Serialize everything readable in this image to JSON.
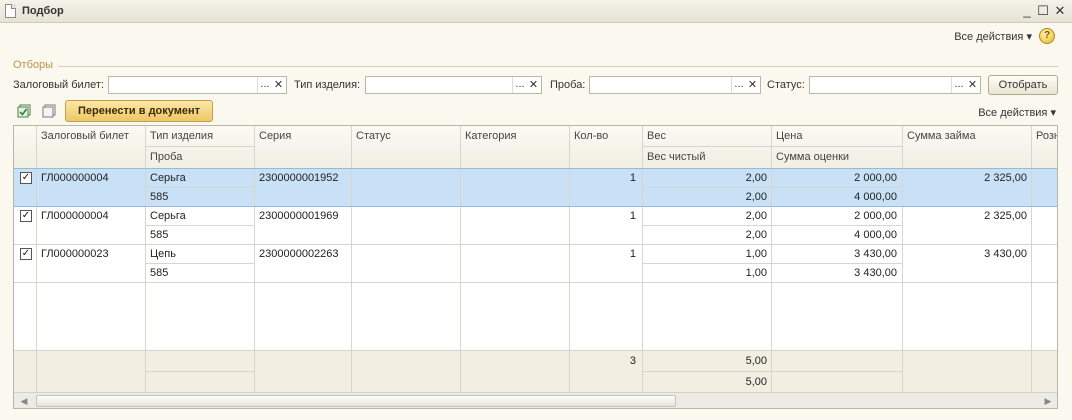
{
  "window": {
    "title": "Подбор"
  },
  "top_actions": {
    "all_actions": "Все действия",
    "help": "?"
  },
  "filters": {
    "section_label": "Отборы",
    "pledge_ticket_label": "Залоговый билет:",
    "item_type_label": "Тип изделия:",
    "probe_label": "Проба:",
    "status_label": "Статус:",
    "pick_label": "...",
    "clear_label": "✕",
    "apply_button": "Отобрать"
  },
  "toolbar": {
    "transfer_button": "Перенести в документ",
    "all_actions": "Все действия"
  },
  "table": {
    "headers": {
      "ticket": "Залоговый билет",
      "item_type": "Тип изделия",
      "probe": "Проба",
      "series": "Серия",
      "status": "Статус",
      "category": "Категория",
      "qty": "Кол-во",
      "weight": "Вес",
      "net_weight": "Вес чистый",
      "price": "Цена",
      "appraisal": "Сумма оценки",
      "loan": "Сумма займа",
      "retail": "Розн"
    },
    "rows": [
      {
        "checked": true,
        "ticket": "ГЛ000000004",
        "item_type": "Серьга",
        "probe": "585",
        "series": "2300000001952",
        "status": "",
        "category": "",
        "qty": "1",
        "weight": "2,00",
        "net_weight": "2,00",
        "price": "2 000,00",
        "appraisal": "4 000,00",
        "loan": "2 325,00"
      },
      {
        "checked": true,
        "ticket": "ГЛ000000004",
        "item_type": "Серьга",
        "probe": "585",
        "series": "2300000001969",
        "status": "",
        "category": "",
        "qty": "1",
        "weight": "2,00",
        "net_weight": "2,00",
        "price": "2 000,00",
        "appraisal": "4 000,00",
        "loan": "2 325,00"
      },
      {
        "checked": true,
        "ticket": "ГЛ000000023",
        "item_type": "Цепь",
        "probe": "585",
        "series": "2300000002263",
        "status": "",
        "category": "",
        "qty": "1",
        "weight": "1,00",
        "net_weight": "1,00",
        "price": "3 430,00",
        "appraisal": "3 430,00",
        "loan": "3 430,00"
      }
    ],
    "totals": {
      "qty": "3",
      "weight": "5,00",
      "net_weight": "5,00"
    },
    "selected_row": 0
  },
  "colors": {
    "accent_filter_label": "#b89440",
    "selection": "#c8e1f7",
    "transfer_button": "#eec766"
  }
}
